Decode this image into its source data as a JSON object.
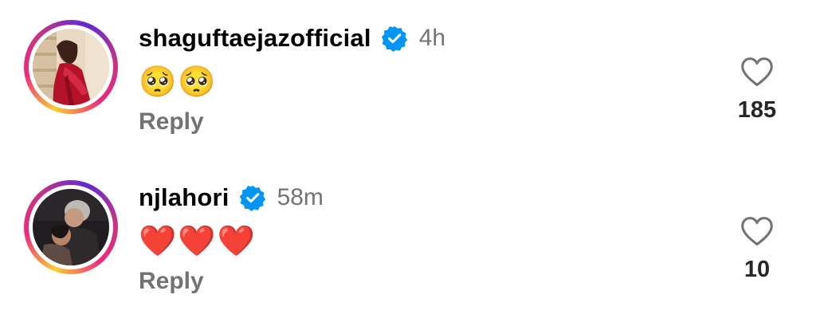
{
  "comments": [
    {
      "username": "shaguftaejazofficial",
      "verified": true,
      "time": "4h",
      "text": "🥺🥺",
      "reply_label": "Reply",
      "like_count": "185",
      "avatar_icon": "profile-photo-woman-red-dress"
    },
    {
      "username": "njlahori",
      "verified": true,
      "time": "58m",
      "text": "❤️❤️❤️",
      "reply_label": "Reply",
      "like_count": "10",
      "avatar_icon": "profile-photo-couple-dark"
    }
  ],
  "colors": {
    "verified_blue": "#0095f6",
    "secondary_text": "#737373",
    "ring_gradient": [
      "#f9ce34",
      "#ee2a7b",
      "#6228d7"
    ]
  }
}
